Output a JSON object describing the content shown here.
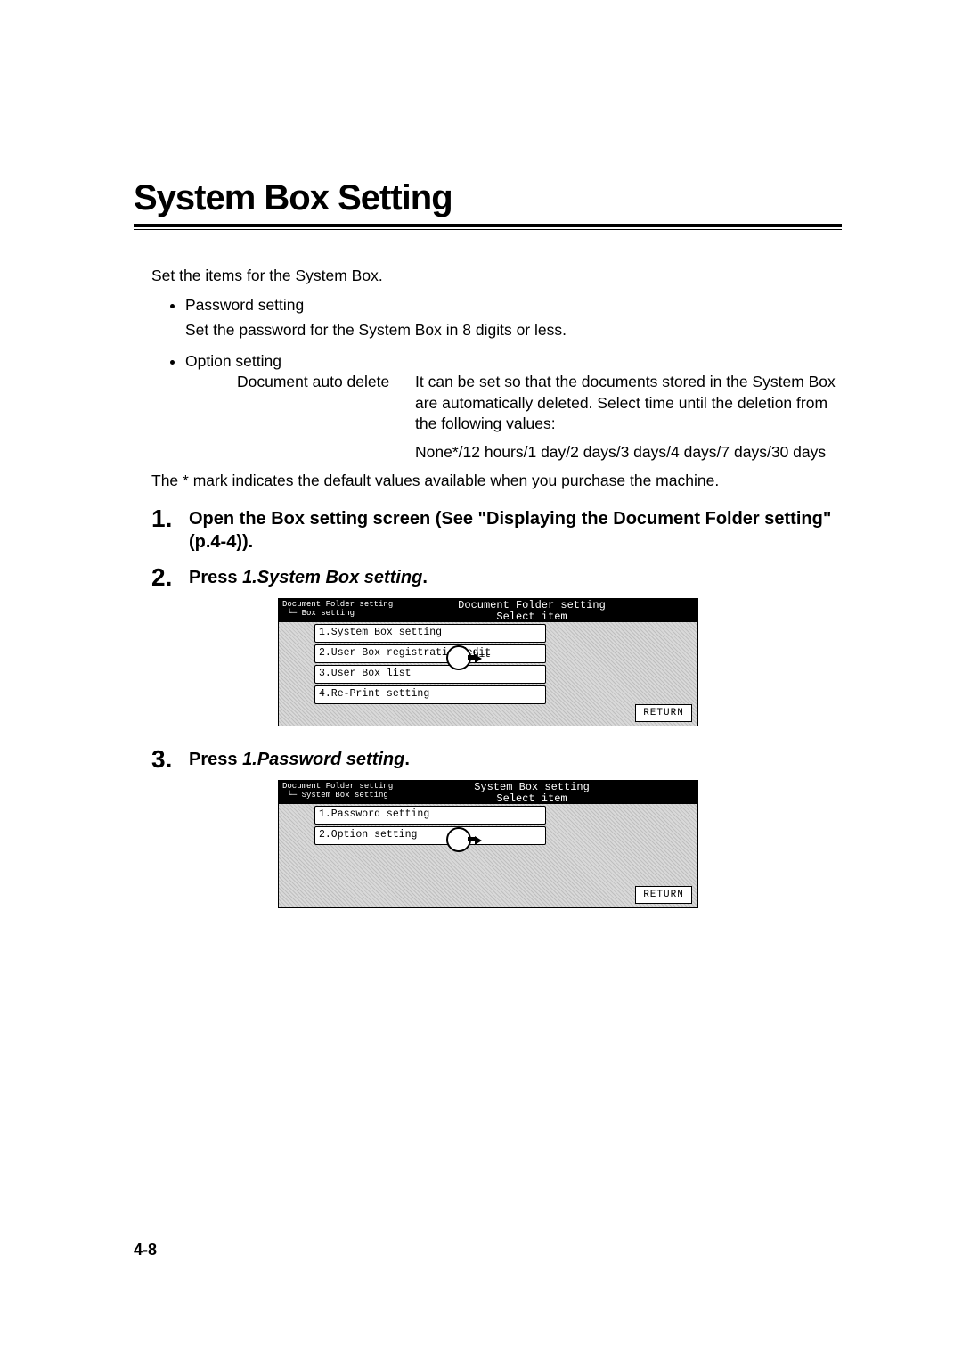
{
  "title": "System Box Setting",
  "intro": "Set the items for the System Box.",
  "bullets": [
    {
      "label": "Password setting",
      "desc": "Set the password for the System Box in 8 digits or less."
    },
    {
      "label": "Option setting",
      "table": [
        {
          "name": "Document auto delete",
          "desc": "It can be set so that the documents stored in the System Box are automatically deleted. Select time until the deletion from the following values:",
          "values": "None*/12 hours/1 day/2 days/3 days/4 days/7 days/30 days"
        }
      ]
    }
  ],
  "footnote": "The * mark indicates the default values available when you purchase the machine.",
  "steps": [
    {
      "text_before": "Open the Box setting screen (See \"Displaying the Document Folder setting\"(p.4-4)).",
      "italic": ""
    },
    {
      "text_before": "Press ",
      "italic": "1.System Box setting",
      "text_after": "."
    },
    {
      "text_before": "Press ",
      "italic": "1.Password setting",
      "text_after": "."
    }
  ],
  "lcd1": {
    "breadcrumb": "Document Folder setting\n └─ Box setting",
    "title": "Document Folder setting\nSelect item",
    "items": [
      "1.System Box setting",
      "2.User Box registration/edit",
      "3.User Box list",
      "4.Re-Print setting"
    ],
    "return": "RETURN",
    "cursor_row": 1,
    "cursor_extra": "bit"
  },
  "lcd2": {
    "breadcrumb": "Document Folder setting\n └─ System Box setting",
    "title": "System Box setting\nSelect item",
    "items": [
      "1.Password setting",
      "2.Option setting"
    ],
    "return": "RETURN",
    "cursor_row": 1
  },
  "page_number": "4-8"
}
